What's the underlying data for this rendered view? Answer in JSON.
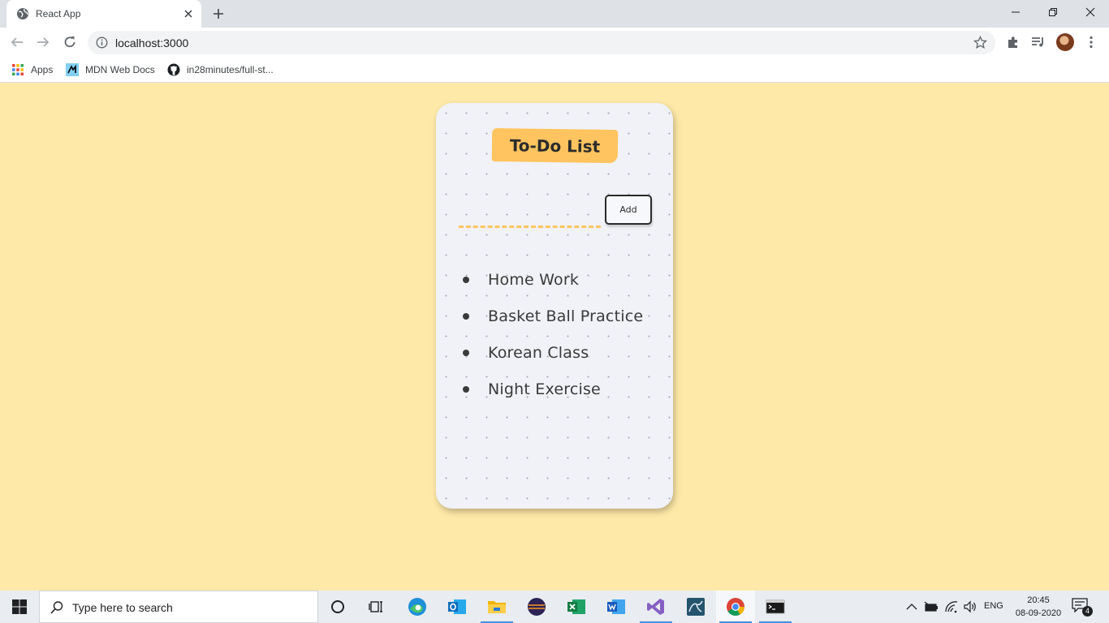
{
  "browser": {
    "tab_title": "React App",
    "url": "localhost:3000",
    "bookmarks": [
      {
        "label": "Apps",
        "icon": "apps-grid-icon"
      },
      {
        "label": "MDN Web Docs",
        "icon": "mdn-icon"
      },
      {
        "label": "in28minutes/full-st...",
        "icon": "github-icon"
      }
    ]
  },
  "app": {
    "title": "To-Do List",
    "input_value": "",
    "add_label": "Add",
    "items": [
      "Home Work",
      "Basket Ball Practice",
      "Korean Class",
      "Night Exercise"
    ],
    "colors": {
      "background": "#ffe9a8",
      "card": "#f0f2f7",
      "accent": "#ffc45f",
      "text": "#2b2b2b"
    }
  },
  "taskbar": {
    "search_placeholder": "Type here to search",
    "apps": [
      "cortana-icon",
      "task-view-icon",
      "edge-icon",
      "outlook-icon",
      "file-explorer-icon",
      "eclipse-icon",
      "excel-icon",
      "word-icon",
      "visual-studio-icon",
      "mysql-workbench-icon",
      "chrome-icon",
      "terminal-icon"
    ],
    "language": "ENG",
    "time": "20:45",
    "date": "08-09-2020",
    "notification_count": "4"
  }
}
